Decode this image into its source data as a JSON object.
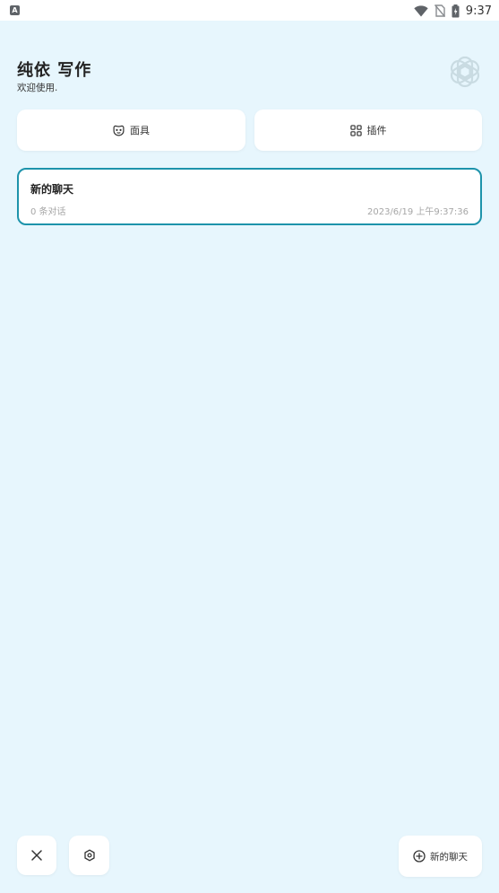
{
  "status_bar": {
    "left_icon_letter": "A",
    "time": "9:37"
  },
  "header": {
    "title": "纯依 写作",
    "subtitle": "欢迎使用.",
    "logo_icon": "openai-logo-icon"
  },
  "top_actions": {
    "mask_label": "面具",
    "mask_icon": "mask-face-icon",
    "plugin_label": "插件",
    "plugin_icon": "grid-plugin-icon"
  },
  "chats": [
    {
      "title": "新的聊天",
      "count": "0 条对话",
      "time": "2023/6/19 上午9:37:36"
    }
  ],
  "bottom_bar": {
    "close_icon": "close-icon",
    "settings_icon": "settings-icon",
    "new_chat_label": "新的聊天",
    "new_chat_icon": "add-circle-icon"
  },
  "colors": {
    "background": "#e7f6fd",
    "accent": "#1d93ab",
    "card": "#ffffff",
    "muted_text": "#a6a6a6"
  }
}
